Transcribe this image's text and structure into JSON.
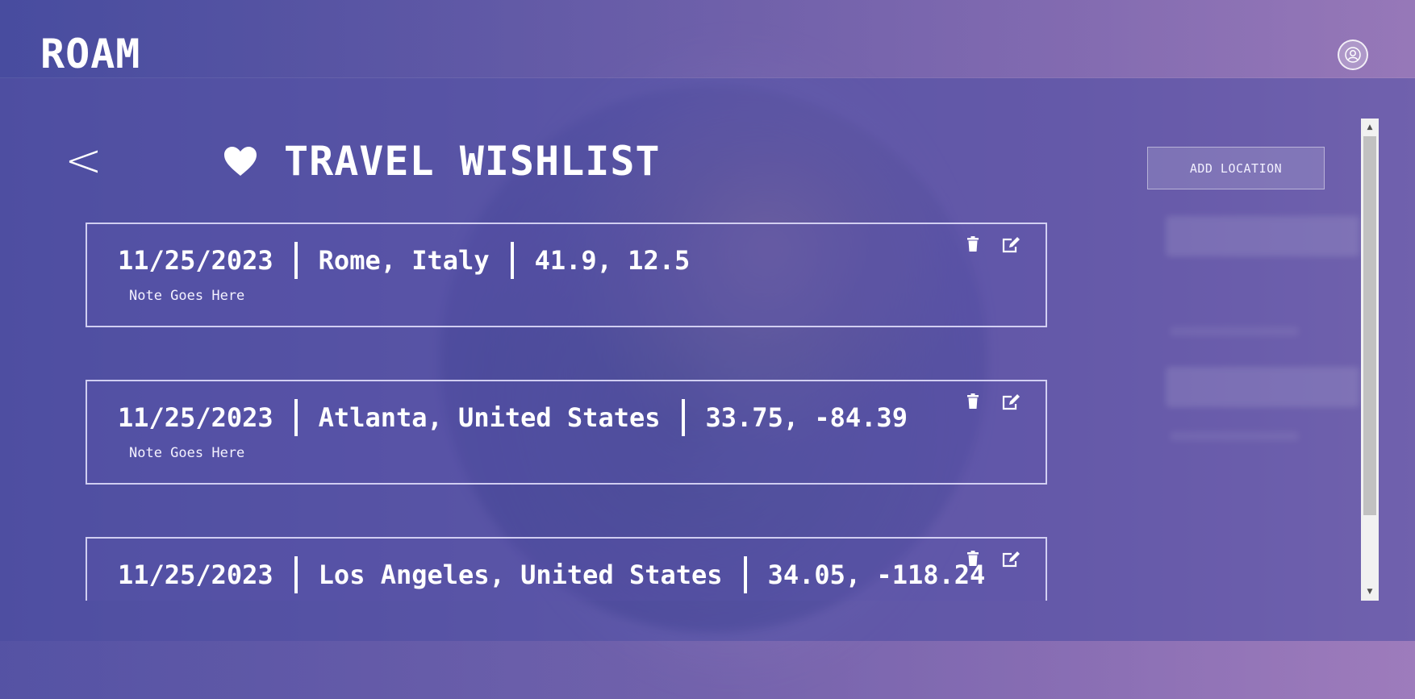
{
  "app": {
    "title": "ROAM"
  },
  "header": {
    "profile_icon": "user-circle-icon"
  },
  "page": {
    "back_label": "<",
    "title": "TRAVEL WISHLIST",
    "title_icon": "heart-icon",
    "add_button_label": "ADD LOCATION"
  },
  "wishlist": [
    {
      "date": "11/25/2023",
      "location": "Rome, Italy",
      "coords": "41.9, 12.5",
      "note": "Note Goes Here"
    },
    {
      "date": "11/25/2023",
      "location": "Atlanta, United States",
      "coords": "33.75, -84.39",
      "note": "Note Goes Here"
    },
    {
      "date": "11/25/2023",
      "location": "Los Angeles, United States",
      "coords": "34.05, -118.24",
      "note": ""
    }
  ],
  "icons": {
    "delete": "trash-icon",
    "edit": "edit-icon"
  },
  "colors": {
    "accent": "#5a57a8",
    "card_border": "#e6e4ff",
    "text": "#ffffff"
  }
}
